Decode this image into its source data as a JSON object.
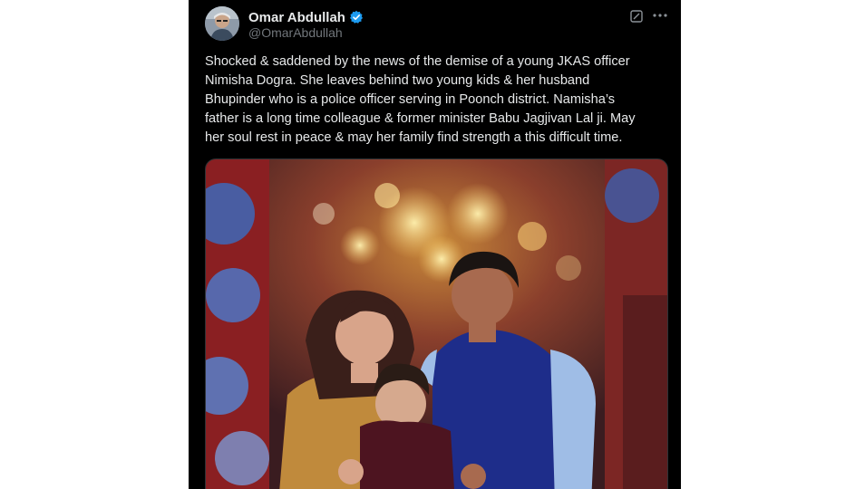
{
  "author": {
    "display_name": "Omar Abdullah",
    "handle": "@OmarAbdullah",
    "verified": true
  },
  "tweet": {
    "lines": [
      "Shocked & saddened by the news of the demise of a young JKAS officer",
      "Nimisha Dogra. She leaves behind two young kids & her husband",
      "Bhupinder who is a police officer serving in Poonch district. Namisha’s",
      "father is a long time colleague & former minister Babu Jagjivan Lal ji. May",
      "her soul rest in peace & may her family find strength a this difficult time."
    ]
  },
  "icons": {
    "verified": "verified-badge-icon",
    "grok": "grok-icon",
    "more": "more-options-icon"
  },
  "colors": {
    "background": "#000000",
    "text_primary": "#e7e9ea",
    "text_secondary": "#71767b",
    "verified_blue": "#1d9bf0"
  }
}
